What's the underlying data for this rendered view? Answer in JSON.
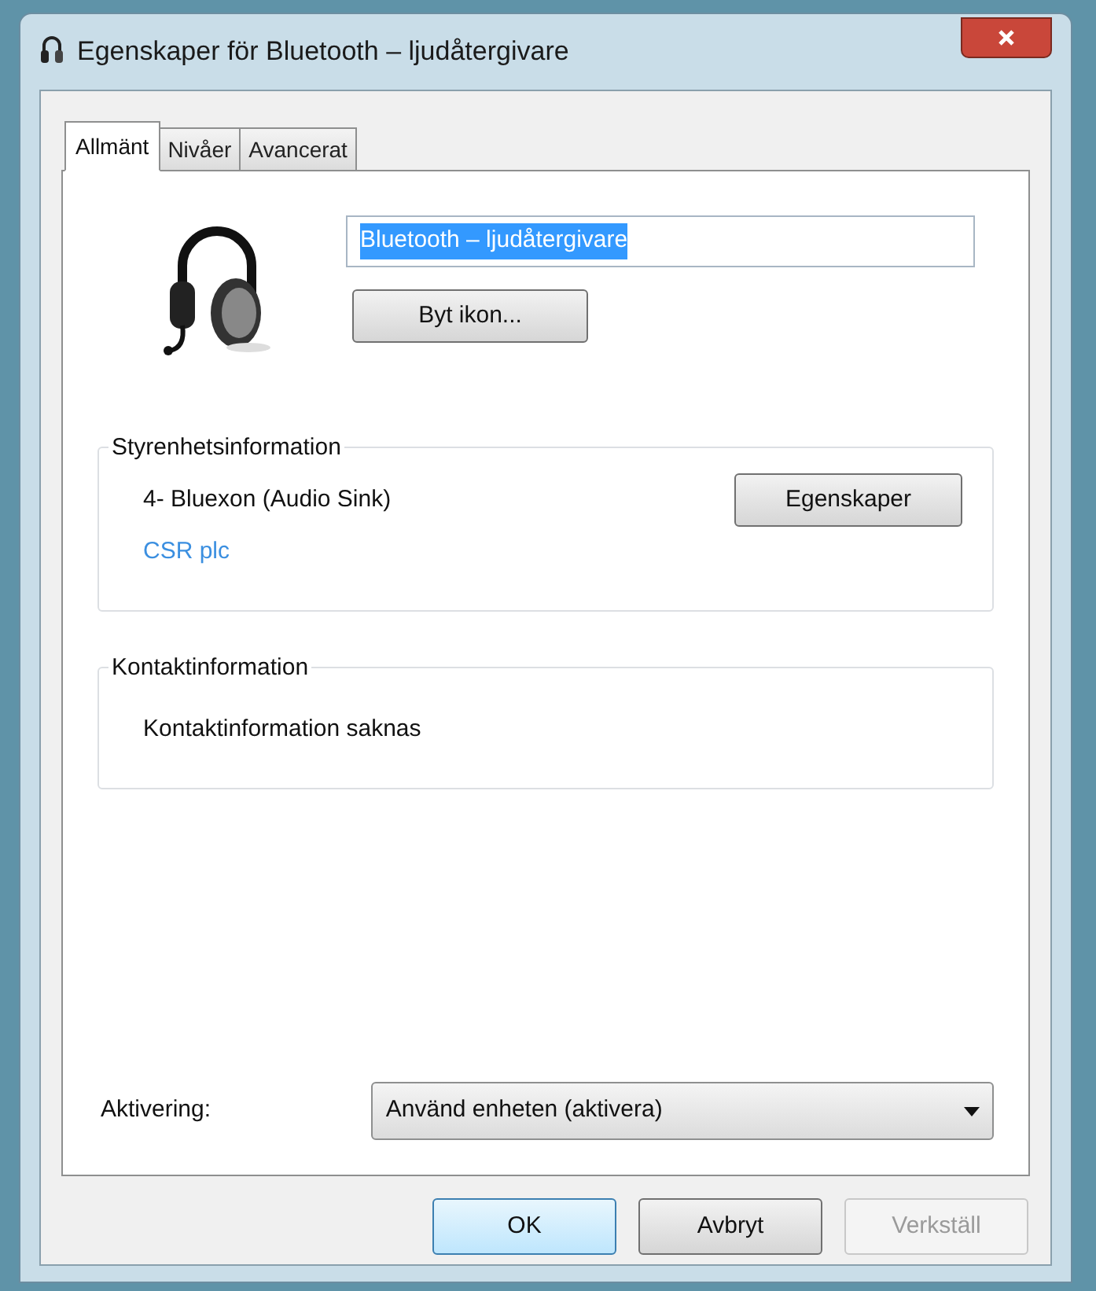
{
  "window": {
    "title": "Egenskaper för Bluetooth – ljudåtergivare"
  },
  "tabs": [
    {
      "label": "Allmänt",
      "selected": true
    },
    {
      "label": "Nivåer",
      "selected": false
    },
    {
      "label": "Avancerat",
      "selected": false
    }
  ],
  "name_field": {
    "value": "Bluetooth – ljudåtergivare",
    "selected": true
  },
  "change_icon_button": "Byt ikon...",
  "controller_group": {
    "title": "Styrenhetsinformation",
    "device": "4- Bluexon (Audio Sink)",
    "manufacturer": "CSR plc",
    "button": "Egenskaper"
  },
  "contact_group": {
    "title": "Kontaktinformation",
    "text": "Kontaktinformation saknas"
  },
  "activation": {
    "label": "Aktivering:",
    "value": "Använd enheten (aktivera)"
  },
  "buttons": [
    {
      "label": "OK",
      "kind": "default",
      "disabled": false
    },
    {
      "label": "Avbryt",
      "kind": "normal",
      "disabled": false
    },
    {
      "label": "Verkställ",
      "kind": "normal",
      "disabled": true
    }
  ]
}
